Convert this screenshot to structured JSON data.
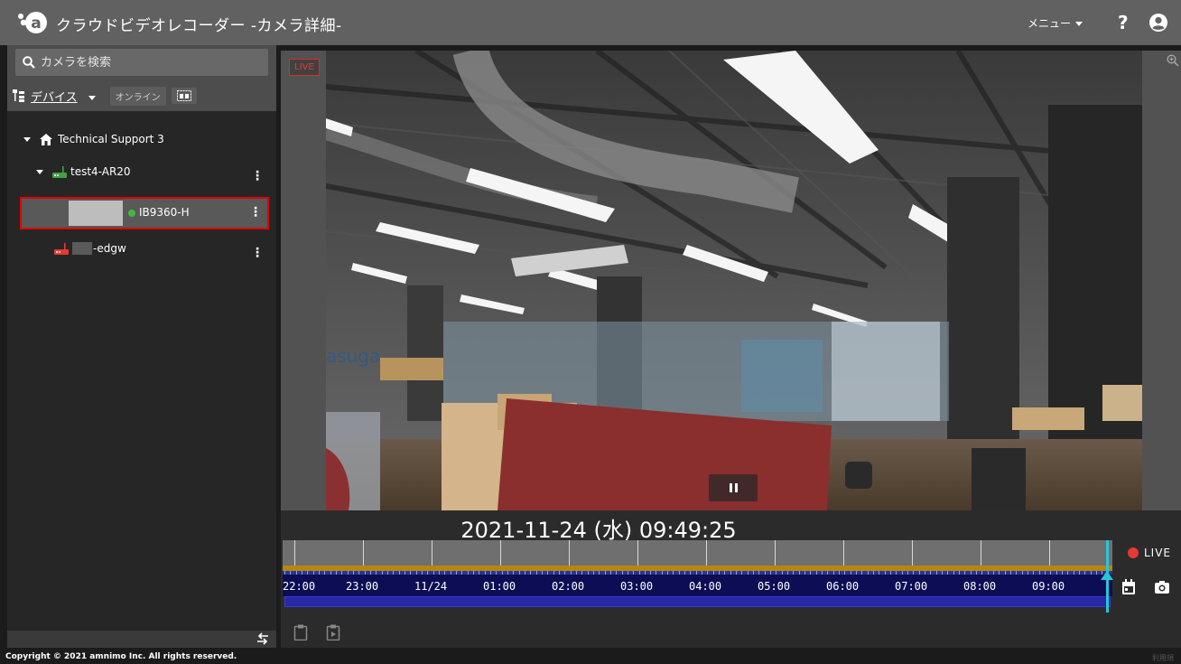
{
  "header": {
    "title": "クラウドビデオレコーダー  -カメラ詳細-",
    "menu_label": "メニュー",
    "help_label": "?"
  },
  "sidebar": {
    "search_placeholder": "カメラを検索",
    "device_filter": "デバイス",
    "online_label": "オンライン",
    "tree": {
      "group": "Technical Support 3",
      "router": "test4-AR20",
      "camera": "IB9360-H",
      "camera_status_color": "#3fba3f",
      "gateway": "-edgw"
    }
  },
  "video": {
    "live_badge": "LIVE",
    "timestamp": "2021-11-24 (水) 09:49:25"
  },
  "timeline": {
    "labels": [
      "22:00",
      "23:00",
      "11/24",
      "01:00",
      "02:00",
      "03:00",
      "04:00",
      "05:00",
      "06:00",
      "07:00",
      "08:00",
      "09:00"
    ],
    "live_label": "LIVE"
  },
  "colors": {
    "header_bg": "#616161",
    "live_red": "#e53935",
    "cursor": "#26c6da",
    "timeline_orange": "#b8860b",
    "timeline_blue": "#2727a8"
  },
  "footer": {
    "copyright": "Copyright © 2021 amnimo Inc. All rights reserved.",
    "terms": "利用規"
  }
}
